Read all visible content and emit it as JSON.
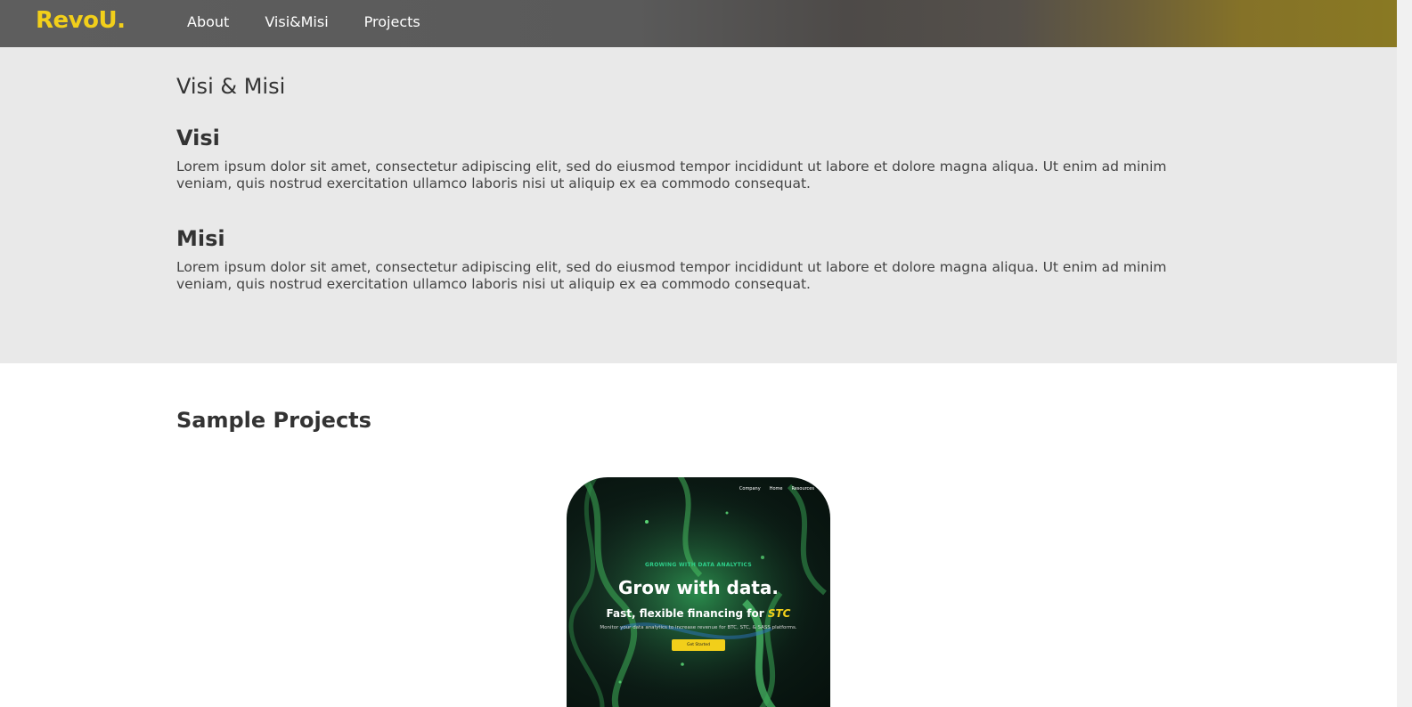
{
  "navbar": {
    "logo": "RevoU.",
    "links": [
      "About",
      "Visi&Misi",
      "Projects"
    ]
  },
  "visi_misi": {
    "title": "Visi & Misi",
    "visi_heading": "Visi",
    "visi_text": "Lorem ipsum dolor sit amet, consectetur adipiscing elit, sed do eiusmod tempor incididunt ut labore et dolore magna aliqua. Ut enim ad minim veniam, quis nostrud exercitation ullamco laboris nisi ut aliquip ex ea commodo consequat.",
    "misi_heading": "Misi",
    "misi_text": "Lorem ipsum dolor sit amet, consectetur adipiscing elit, sed do eiusmod tempor incididunt ut labore et dolore magna aliqua. Ut enim ad minim veniam, quis nostrud exercitation ullamco laboris nisi ut aliquip ex ea commodo consequat."
  },
  "projects": {
    "title": "Sample Projects",
    "card": {
      "nav": [
        "Company",
        "Home",
        "Resources"
      ],
      "eyebrow": "GROWING WITH DATA ANALYTICS",
      "headline": "Grow with data.",
      "sub_prefix": "Fast, flexible financing for ",
      "sub_accent": "STC",
      "small": "Monitor your data analytics to increase revenue for BTC, STC, & SASS platforms.",
      "button": "Get Started"
    }
  },
  "colors": {
    "brand_yellow": "#f2cf1a",
    "section_gray": "#e9e9e9",
    "eyebrow_green": "#2ecf8a"
  }
}
